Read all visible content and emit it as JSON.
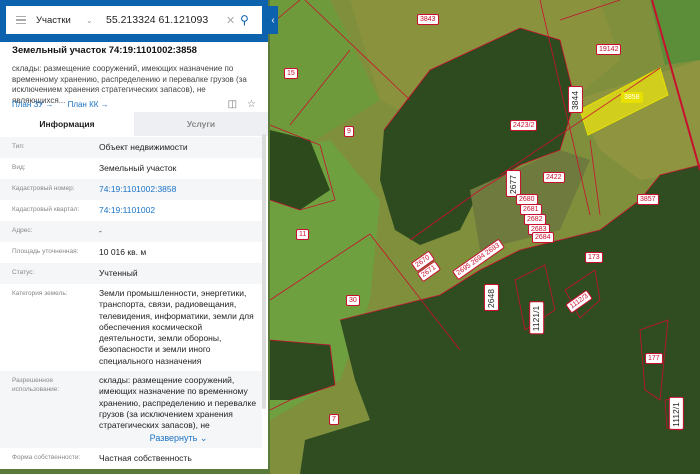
{
  "search": {
    "layer": "Участки",
    "query": "55.213324 61.121093"
  },
  "card": {
    "title": "Земельный участок 74:19:1101002:3858",
    "description": "склады: размещение сооружений, имеющих назначение по временному хранению, распределению и перевалке грузов (за исключением хранения стратегических запасов), не являющихся...",
    "link_plan_zu": "План ЗУ →",
    "link_plan_kk": "План КК →"
  },
  "tabs": [
    {
      "label": "Информация"
    },
    {
      "label": "Услуги"
    }
  ],
  "rows": [
    {
      "key": "Тип:",
      "value": "Объект недвижимости"
    },
    {
      "key": "Вид:",
      "value": "Земельный участок"
    },
    {
      "key": "Кадастровый номер:",
      "value": "74:19:1101002:3858"
    },
    {
      "key": "Кадастровый квартал:",
      "value": "74:19:1101002"
    },
    {
      "key": "Адрес:",
      "value": "-"
    },
    {
      "key": "Площадь уточненная:",
      "value": "10 016 кв. м"
    },
    {
      "key": "Статус:",
      "value": "Учтенный"
    },
    {
      "key": "Категория земель:",
      "value": "Земли промышленности, энергетики, транспорта, связи, радиовещания, телевидения, информатики, земли для обеспечения космической деятельности, земли обороны, безопасности и земли иного специального назначения"
    },
    {
      "key": "Разрешенное использование:",
      "value": "склады: размещение сооружений, имеющих назначение по временному хранению, распределению и перевалке грузов (за исключением хранения стратегических запасов), не являющихся..."
    },
    {
      "key": "Форма собственности:",
      "value": "Частная собственность"
    }
  ],
  "expand_label": "Развернуть",
  "map": {
    "labels": [
      "3843",
      "19142",
      "15",
      "3858",
      "3844",
      "2423/2",
      "9",
      "2422",
      "3857",
      "11",
      "2677",
      "2680",
      "2681",
      "2682",
      "2683",
      "2684",
      "2670",
      "2671",
      "30",
      "2695 2694 2693",
      "2648",
      "1121/1",
      "1112/3",
      "173",
      "177",
      "7",
      "1112/1"
    ]
  }
}
